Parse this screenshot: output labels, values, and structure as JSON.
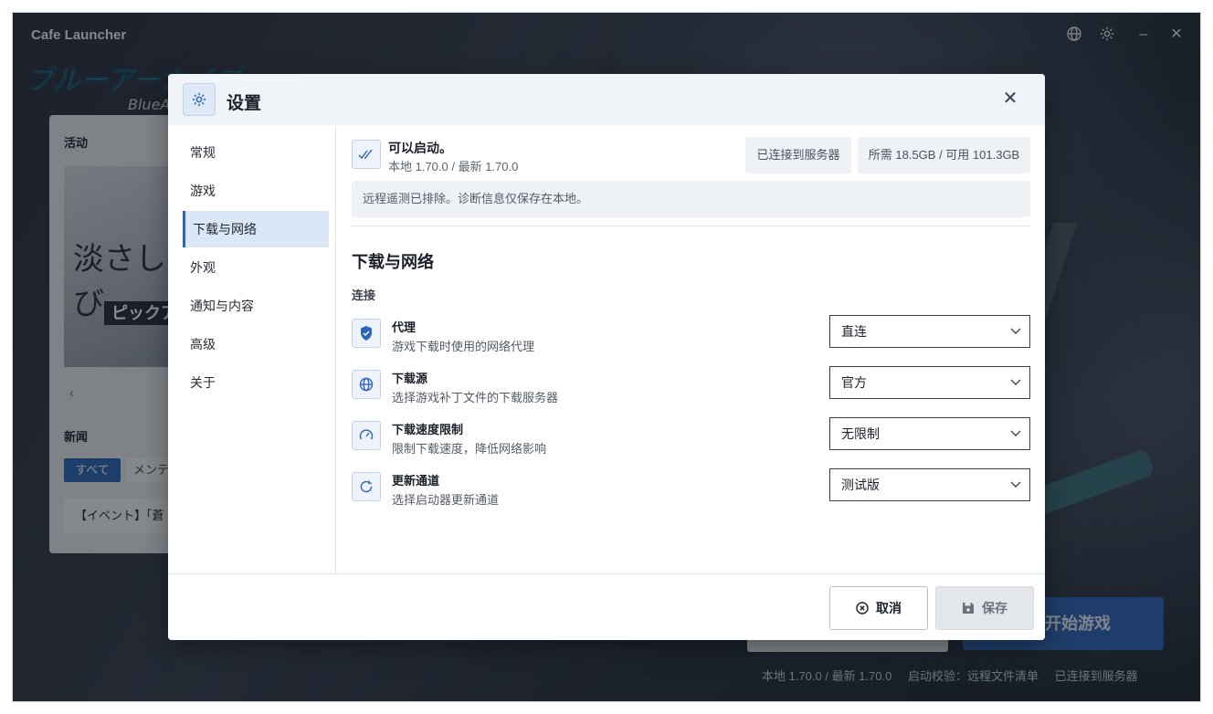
{
  "app": {
    "title": "Cafe Launcher",
    "logo_text": "ブルーアーカイブ",
    "logo_sub": "BlueA"
  },
  "window_controls": {
    "language_icon": "globe-icon",
    "settings_icon": "gear-icon",
    "minimize": "–",
    "close": "✕"
  },
  "background": {
    "activity_label": "活动",
    "banner_text": "淡さしび",
    "banner_band": "ピックア",
    "carousel_prev": "‹",
    "news_label": "新闻",
    "news_tabs": [
      "すべて",
      "メンテ"
    ],
    "news_item": "【イベント】「蒼",
    "start_button": "开始游戏",
    "status": {
      "version": "本地 1.70.0 / 最新 1.70.0",
      "check": "启动校验：远程文件清单",
      "server": "已连接到服务器"
    }
  },
  "dialog": {
    "title": "设置",
    "close": "✕",
    "nav": [
      "常规",
      "游戏",
      "下载与网络",
      "外观",
      "通知与内容",
      "高级",
      "关于"
    ],
    "active_nav": "下载与网络",
    "status": {
      "title": "可以启动。",
      "version": "本地 1.70.0 / 最新 1.70.0",
      "server_chip": "已连接到服务器",
      "storage_chip": "所需 18.5GB / 可用 101.3GB",
      "notice": "远程遥测已排除。诊断信息仅保存在本地。"
    },
    "section_title": "下载与网络",
    "group_label": "连接",
    "rows": [
      {
        "title": "代理",
        "desc": "游戏下载时使用的网络代理",
        "value": "直连",
        "icon": "shield-icon"
      },
      {
        "title": "下载源",
        "desc": "选择游戏补丁文件的下载服务器",
        "value": "官方",
        "icon": "globe-icon"
      },
      {
        "title": "下载速度限制",
        "desc": "限制下载速度，降低网络影响",
        "value": "无限制",
        "icon": "speedometer-icon"
      },
      {
        "title": "更新通道",
        "desc": "选择启动器更新通道",
        "value": "测试版",
        "icon": "refresh-icon"
      }
    ],
    "footer": {
      "cancel": "取消",
      "save": "保存"
    }
  },
  "colors": {
    "accent": "#2d66b8",
    "active_nav_bg": "#dbe6f6"
  }
}
